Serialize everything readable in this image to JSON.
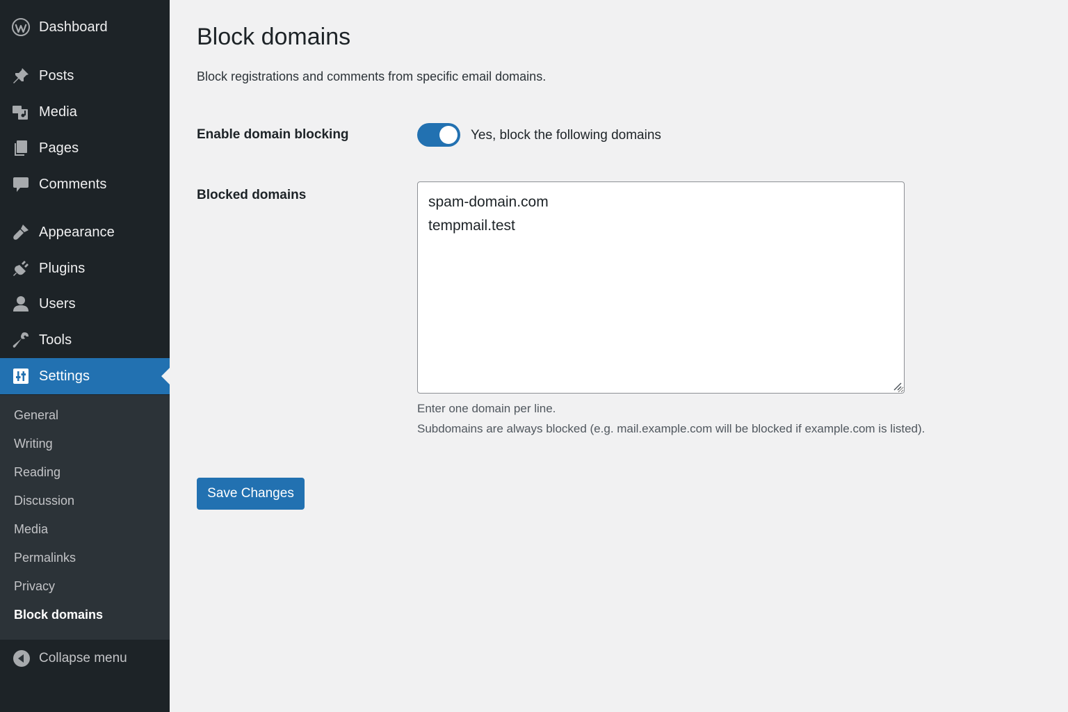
{
  "sidebar": {
    "dashboard": "Dashboard",
    "posts": "Posts",
    "media": "Media",
    "pages": "Pages",
    "comments": "Comments",
    "appearance": "Appearance",
    "plugins": "Plugins",
    "users": "Users",
    "tools": "Tools",
    "settings": "Settings",
    "collapse": "Collapse menu"
  },
  "submenu": {
    "general": "General",
    "writing": "Writing",
    "reading": "Reading",
    "discussion": "Discussion",
    "media": "Media",
    "permalinks": "Permalinks",
    "privacy": "Privacy",
    "block_domains": "Block domains"
  },
  "main": {
    "title": "Block domains",
    "description": "Block registrations and comments from specific email domains.",
    "enable_label": "Enable domain blocking",
    "toggle_label": "Yes, block the following domains",
    "toggle_state": "on",
    "blocked_label": "Blocked domains",
    "blocked_value": "spam-domain.com\ntempmail.test",
    "help_line1": "Enter one domain per line.",
    "help_line2": "Subdomains are always blocked (e.g. mail.example.com will be blocked if example.com is listed).",
    "save_label": "Save Changes"
  },
  "colors": {
    "sidebar_bg": "#1d2327",
    "submenu_bg": "#2c3338",
    "accent": "#2271b1",
    "page_bg": "#f1f1f2"
  },
  "icons": [
    "wordpress-logo-icon",
    "pushpin-icon",
    "media-icon",
    "pages-icon",
    "comment-icon",
    "paintbrush-icon",
    "plugin-icon",
    "user-icon",
    "wrench-icon",
    "settings-sliders-icon",
    "collapse-arrow-icon"
  ]
}
